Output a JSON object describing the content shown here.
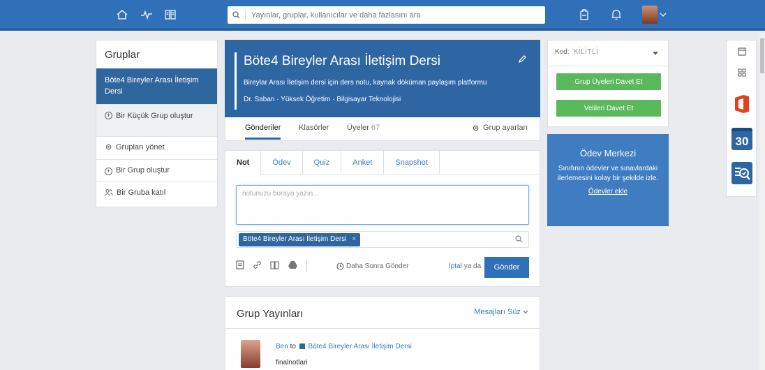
{
  "topbar": {
    "search_placeholder": "Yayınlar, gruplar, kullanıcılar ve daha fazlasını ara",
    "icons": [
      "home-icon",
      "activity-icon",
      "book-icon",
      "backpack-icon",
      "bell-icon"
    ]
  },
  "sidebar": {
    "title": "Gruplar",
    "active_group": "Böte4 Bireyler Arası İletişim Dersi",
    "items": [
      {
        "label": "Bir Küçük Grup oluştur"
      },
      {
        "label": "Grupları yönet"
      },
      {
        "label": "Bir Grup oluştur"
      },
      {
        "label": "Bir Gruba katıl"
      }
    ]
  },
  "group": {
    "title": "Böte4 Bireyler Arası İletişim Dersi",
    "description": "Bireylar Arası İletişim dersi için ders notu, kaynak döküman paylaşım platformu",
    "meta": "Dr. Saban · Yüksek Öğretim · Bilgisayar Teknolojisi"
  },
  "tabs": {
    "posts": "Gönderiler",
    "folders": "Klasörler",
    "members": "Üyeler",
    "members_count": "67",
    "settings": "Grup ayarları"
  },
  "composer": {
    "tabs": [
      "Not",
      "Ödev",
      "Quiz",
      "Anket",
      "Snapshot"
    ],
    "placeholder": "notunuzu buraya yazın...",
    "recipient": "Böte4 Bireyler Arası İletişim Dersi",
    "send_later": "Daha Sonra Gönder",
    "cancel": "İptal",
    "or": "ya da",
    "send": "Gönder"
  },
  "posts": {
    "title": "Grup Yayınları",
    "filter": "Mesajları Süz",
    "first": {
      "author": "Ben",
      "to": "to",
      "group": "Böte4 Bireyler Arası İletişim Dersi",
      "body": "finalnotlari"
    }
  },
  "code": {
    "label": "Kod:",
    "value": "KİLİTLİ",
    "invite_members": "Grup Üyeleri Davet Et",
    "invite_parents": "Velileri Davet Et"
  },
  "homework": {
    "title": "Ödev Merkezi",
    "text": "Sınıfının ödevler ve sınavlardaki ilerlemesini kolay bir şekilde izle.",
    "link": "Ödevler ekle"
  },
  "apps": {
    "calendar_day": "30"
  }
}
